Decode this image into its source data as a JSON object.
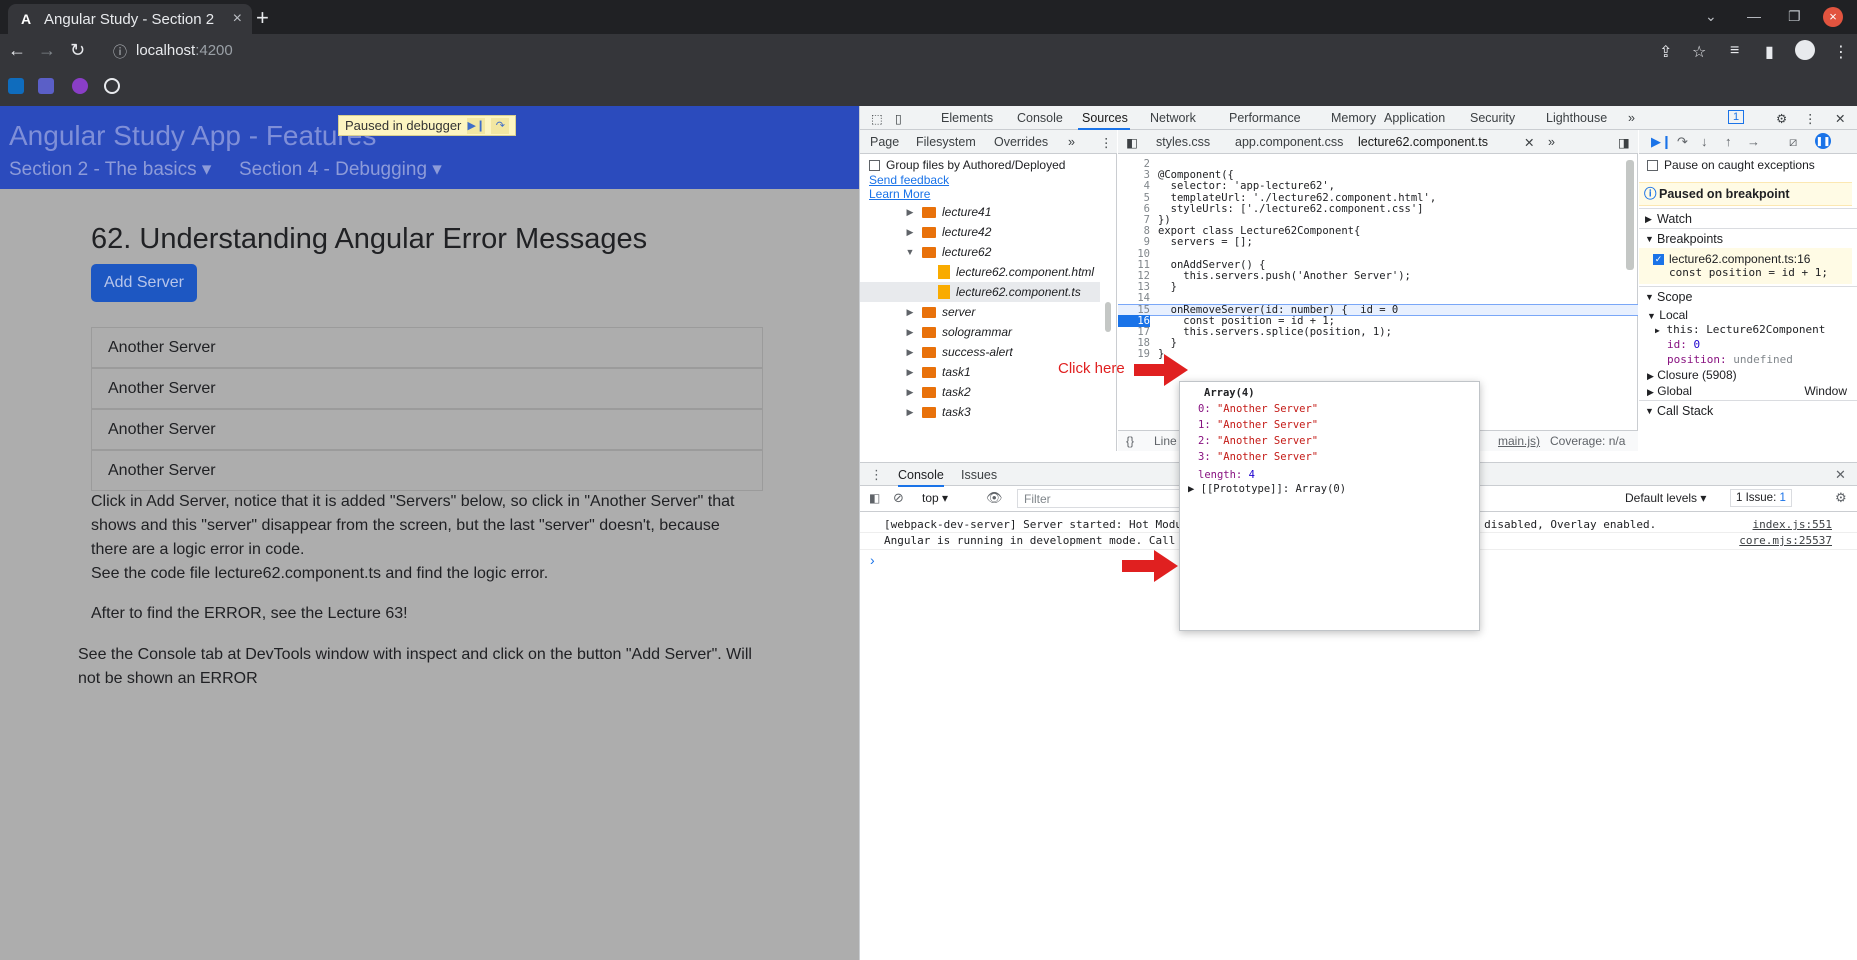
{
  "browser": {
    "tab_title": "Angular Study - Section 2",
    "tab_close": "×",
    "new_tab": "+",
    "url_host": "localhost",
    "url_port": ":4200",
    "window_close": "×"
  },
  "app": {
    "brand": "Angular Study App - Features",
    "menu": [
      "Section 2 - The basics",
      "Section 4 - Debugging"
    ],
    "debugger_banner": "Paused in debugger",
    "title": "62. Understanding Angular Error Messages",
    "add_button": "Add Server",
    "servers": [
      "Another Server",
      "Another Server",
      "Another Server",
      "Another Server"
    ],
    "para1": [
      "Click in Add Server, notice that it is added \"Servers\" below, so click in \"Another Server\" that",
      "shows and this \"server\" disappear from the screen, but the last \"server\" doesn't, because",
      "there are a logic error in code.",
      "See the code file lecture62.component.ts and find the logic error."
    ],
    "para2": "After to find the ERROR, see the Lecture 63!",
    "para3": [
      "See the Console tab at DevTools window with inspect and click on the button \"Add Server\". Will",
      "not be shown an ERROR"
    ]
  },
  "devtools": {
    "tabs": [
      "Elements",
      "Console",
      "Sources",
      "Network",
      "Performance",
      "Memory",
      "Application",
      "Security",
      "Lighthouse"
    ],
    "more": "»",
    "issues_count": "1",
    "nav_tabs": [
      "Page",
      "Filesystem",
      "Overrides"
    ],
    "group_files": "Group files by Authored/Deployed",
    "send_feedback": "Send feedback",
    "learn_more": "Learn More",
    "tree": [
      {
        "label": "lecture41",
        "kind": "folder",
        "arrow": "▶"
      },
      {
        "label": "lecture42",
        "kind": "folder",
        "arrow": "▶"
      },
      {
        "label": "lecture62",
        "kind": "folder",
        "arrow": "▼"
      },
      {
        "label": "lecture62.component.html",
        "kind": "file",
        "arrow": ""
      },
      {
        "label": "lecture62.component.ts",
        "kind": "file",
        "arrow": ""
      },
      {
        "label": "server",
        "kind": "folder",
        "arrow": "▶"
      },
      {
        "label": "sologrammar",
        "kind": "folder",
        "arrow": "▶"
      },
      {
        "label": "success-alert",
        "kind": "folder",
        "arrow": "▶"
      },
      {
        "label": "task1",
        "kind": "folder",
        "arrow": "▶"
      },
      {
        "label": "task2",
        "kind": "folder",
        "arrow": "▶"
      },
      {
        "label": "task3",
        "kind": "folder",
        "arrow": "▶"
      }
    ],
    "editor_tabs": [
      "styles.css",
      "app.component.css",
      "lecture62.component.ts"
    ],
    "code_lines": [
      {
        "n": "2",
        "t": ""
      },
      {
        "n": "3",
        "t": "@Component({"
      },
      {
        "n": "4",
        "t": "  selector: 'app-lecture62',"
      },
      {
        "n": "5",
        "t": "  templateUrl: './lecture62.component.html',"
      },
      {
        "n": "6",
        "t": "  styleUrls: ['./lecture62.component.css']"
      },
      {
        "n": "7",
        "t": "})"
      },
      {
        "n": "8",
        "t": "export class Lecture62Component{"
      },
      {
        "n": "9",
        "t": "  servers = [];"
      },
      {
        "n": "10",
        "t": ""
      },
      {
        "n": "11",
        "t": "  onAddServer() {"
      },
      {
        "n": "12",
        "t": "    this.servers.push('Another Server');"
      },
      {
        "n": "13",
        "t": "  }"
      },
      {
        "n": "14",
        "t": ""
      },
      {
        "n": "15",
        "t": "  onRemoveServer(id: number) {  id = 0"
      },
      {
        "n": "16",
        "t": "    const position = id + 1;"
      },
      {
        "n": "17",
        "t": "    this.servers.splice(position, 1);"
      },
      {
        "n": "18",
        "t": "  }"
      },
      {
        "n": "19",
        "t": "}"
      }
    ],
    "status_line": "Line",
    "status_main": "main.js)",
    "status_coverage": "Coverage: n/a",
    "pause_exceptions": "Pause on caught exceptions",
    "paused_on": "Paused on breakpoint",
    "watch": "Watch",
    "breakpoints": "Breakpoints",
    "bp_file": "lecture62.component.ts:16",
    "bp_code": "const position = id + 1;",
    "scope": "Scope",
    "local": "Local",
    "scope_this": "this: Lecture62Component",
    "scope_id_key": "id:",
    "scope_id_val": "0",
    "scope_pos_key": "position:",
    "scope_pos_val": "undefined",
    "closure": "Closure (5908)",
    "global": "Global",
    "global_val": "Window",
    "call_stack": "Call Stack"
  },
  "console": {
    "tabs": [
      "Console",
      "Issues"
    ],
    "context": "top",
    "filter_placeholder": "Filter",
    "levels": "Default levels",
    "issues_badge": "1 Issue:",
    "issues_num": "1",
    "messages": [
      {
        "text": "[webpack-dev-server] Server started: Hot Modu",
        "tail": "ed, Progress disabled, Overlay enabled.",
        "src": "index.js:551"
      },
      {
        "text": "Angular is running in development mode. Call",
        "tail": "",
        "src": "core.mjs:25537"
      }
    ],
    "prompt": "›"
  },
  "popup": {
    "header": "Array(4)",
    "items": [
      {
        "k": "0:",
        "v": "\"Another Server\""
      },
      {
        "k": "1:",
        "v": "\"Another Server\""
      },
      {
        "k": "2:",
        "v": "\"Another Server\""
      },
      {
        "k": "3:",
        "v": "\"Another Server\""
      }
    ],
    "length_key": "length:",
    "length_val": "4",
    "proto": "▶ [[Prototype]]: Array(0)"
  },
  "annotation": {
    "click_here": "Click here"
  },
  "colors": {
    "navbar": "#2b4bbd",
    "button": "#1d57c2",
    "arrow": "#e02020",
    "accent": "#1a73e8"
  }
}
